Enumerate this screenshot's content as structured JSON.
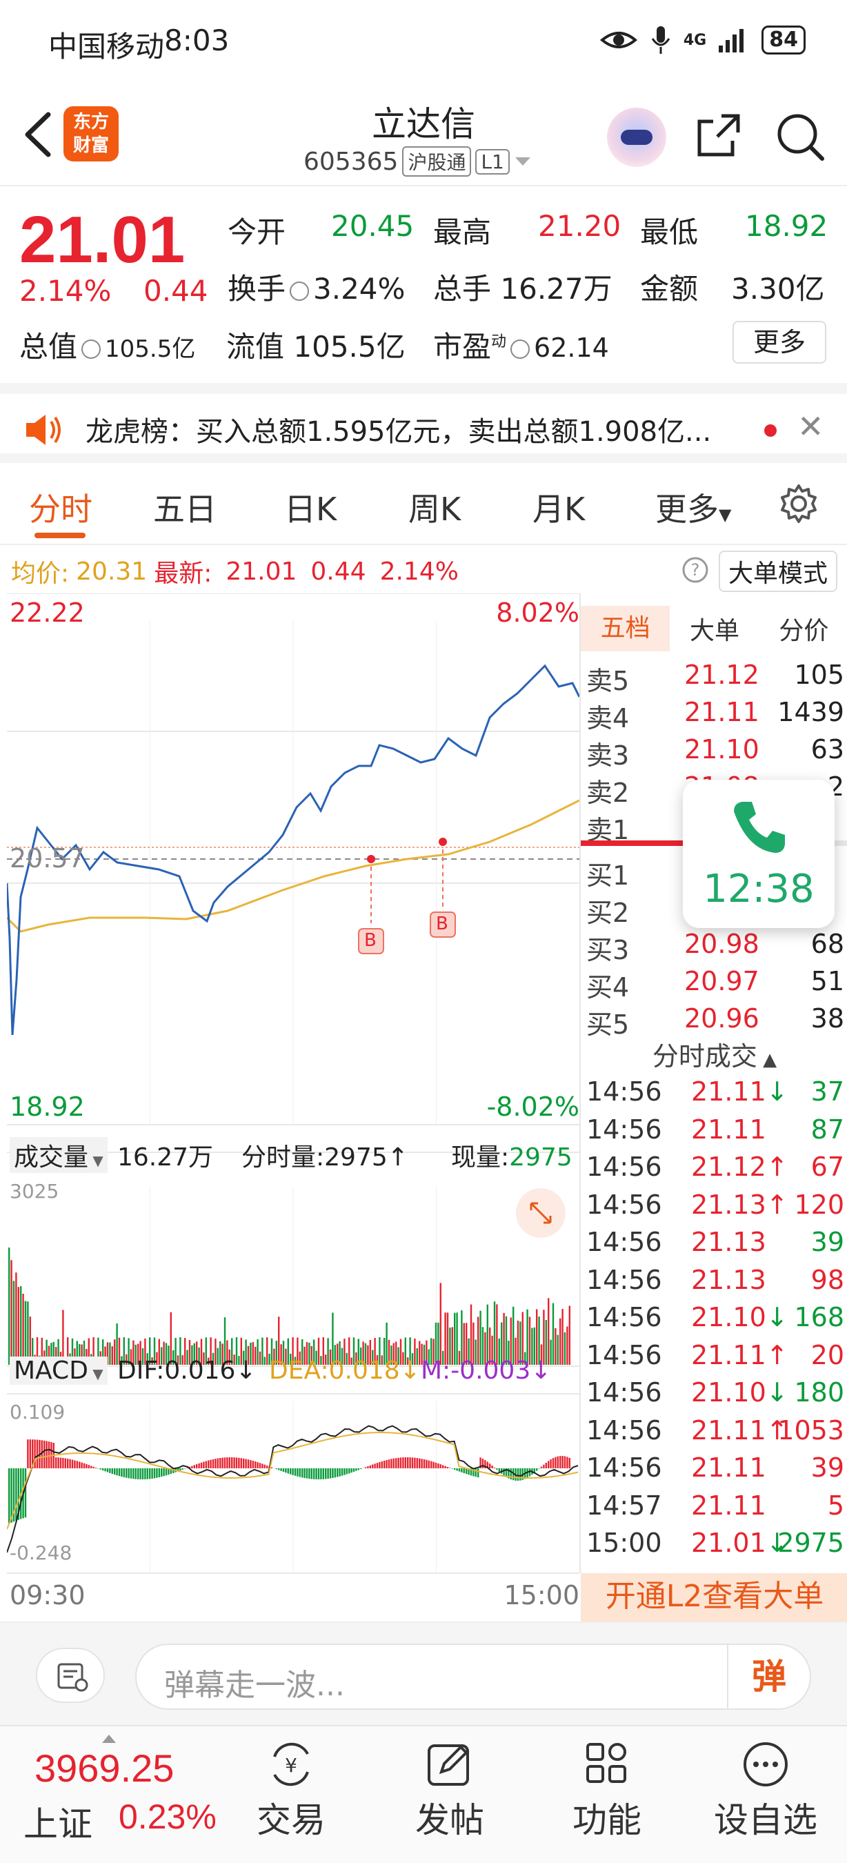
{
  "status_bar": {
    "carrier": "中国移动",
    "time": "8:03",
    "network": "4G",
    "battery": "84"
  },
  "header": {
    "title": "立达信",
    "code": "605365",
    "market_tag": "沪股通",
    "level_tag": "L1",
    "logo_line1": "东方",
    "logo_line2": "财富"
  },
  "quote": {
    "price": "21.01",
    "change_pct": "2.14%",
    "change": "0.44",
    "open_label": "今开",
    "open": "20.45",
    "high_label": "最高",
    "high": "21.20",
    "low_label": "最低",
    "low": "18.92",
    "turnover_label": "换手",
    "turnover": "3.24%",
    "volume_label": "总手",
    "volume": "16.27万",
    "amount_label": "金额",
    "amount": "3.30亿",
    "mcap_label": "总值",
    "mcap": "105.5亿",
    "float_label": "流值",
    "float_mcap": "105.5亿",
    "pe_label": "市盈",
    "pe_sup": "动",
    "pe": "62.14",
    "more": "更多"
  },
  "news": {
    "text": "龙虎榜：买入总额1.595亿元，卖出总额1.908亿..."
  },
  "tabs": [
    "分时",
    "五日",
    "日K",
    "周K",
    "月K",
    "更多"
  ],
  "avg_bar": {
    "avg_label": "均价:",
    "avg": "20.31",
    "latest_label": "最新:",
    "latest": "21.01",
    "chg": "0.44",
    "pct": "2.14%",
    "mode": "大单模式"
  },
  "chart_labels": {
    "top_price": "22.22",
    "top_pct": "8.02%",
    "mid_price": "20.57",
    "bottom_price": "18.92",
    "bottom_pct": "-8.02%",
    "vol_label": "成交量",
    "vol_total": "16.27万",
    "tick_vol": "分时量:2975↑",
    "now_vol_label": "现量:",
    "now_vol": "2975",
    "vol_max": "3025",
    "macd_label": "MACD",
    "dif": "DIF:0.016↓",
    "dea": "DEA:0.018↓",
    "m": "M:-0.003↓",
    "macd_top": "0.109",
    "macd_bottom": "-0.248",
    "time_start": "09:30",
    "time_end": "15:00",
    "buy_marker": "B"
  },
  "order_book": {
    "tabs": [
      "五档",
      "大单",
      "分价"
    ],
    "asks": [
      {
        "label": "卖5",
        "price": "21.12",
        "vol": "105"
      },
      {
        "label": "卖4",
        "price": "21.11",
        "vol": "1439"
      },
      {
        "label": "卖3",
        "price": "21.10",
        "vol": "63"
      },
      {
        "label": "卖2",
        "price": "21.08",
        "vol": "2"
      },
      {
        "label": "卖1",
        "price": "",
        "vol": ""
      }
    ],
    "bids": [
      {
        "label": "买1",
        "price": "",
        "vol": ""
      },
      {
        "label": "买2",
        "price": "",
        "vol": ""
      },
      {
        "label": "买3",
        "price": "20.98",
        "vol": "68"
      },
      {
        "label": "买4",
        "price": "20.97",
        "vol": "51"
      },
      {
        "label": "买5",
        "price": "20.96",
        "vol": "38"
      }
    ],
    "trades_header": "分时成交",
    "trades": [
      {
        "time": "14:56",
        "price": "21.11",
        "dir": "↓",
        "vol": "37",
        "color": "green"
      },
      {
        "time": "14:56",
        "price": "21.11",
        "dir": "",
        "vol": "87",
        "color": "green"
      },
      {
        "time": "14:56",
        "price": "21.12",
        "dir": "↑",
        "vol": "67",
        "color": "red"
      },
      {
        "time": "14:56",
        "price": "21.13",
        "dir": "↑",
        "vol": "120",
        "color": "red"
      },
      {
        "time": "14:56",
        "price": "21.13",
        "dir": "",
        "vol": "39",
        "color": "green"
      },
      {
        "time": "14:56",
        "price": "21.13",
        "dir": "",
        "vol": "98",
        "color": "red"
      },
      {
        "time": "14:56",
        "price": "21.10",
        "dir": "↓",
        "vol": "168",
        "color": "green"
      },
      {
        "time": "14:56",
        "price": "21.11",
        "dir": "↑",
        "vol": "20",
        "color": "red"
      },
      {
        "time": "14:56",
        "price": "21.10",
        "dir": "↓",
        "vol": "180",
        "color": "green"
      },
      {
        "time": "14:56",
        "price": "21.11",
        "dir": "↑",
        "vol": "1053",
        "color": "red"
      },
      {
        "time": "14:56",
        "price": "21.11",
        "dir": "",
        "vol": "39",
        "color": "red"
      },
      {
        "time": "14:57",
        "price": "21.11",
        "dir": "",
        "vol": "5",
        "color": "red"
      },
      {
        "time": "15:00",
        "price": "21.01",
        "dir": "↓",
        "vol": "2975",
        "color": "green"
      }
    ],
    "l2_banner": "开通L2查看大单"
  },
  "call_popup": {
    "time": "12:38"
  },
  "danmu": {
    "placeholder": "弹幕走一波...",
    "button": "弹"
  },
  "bottom_nav": {
    "index_value": "3969.25",
    "index_name": "上证",
    "index_pct": "0.23%",
    "items": [
      "交易",
      "发帖",
      "功能",
      "设自选"
    ]
  },
  "colors": {
    "up": "#e6232f",
    "down": "#0a9b3a",
    "accent": "#e8591a",
    "price_line": "#2a62b5",
    "avg_line": "#e8b43a"
  }
}
